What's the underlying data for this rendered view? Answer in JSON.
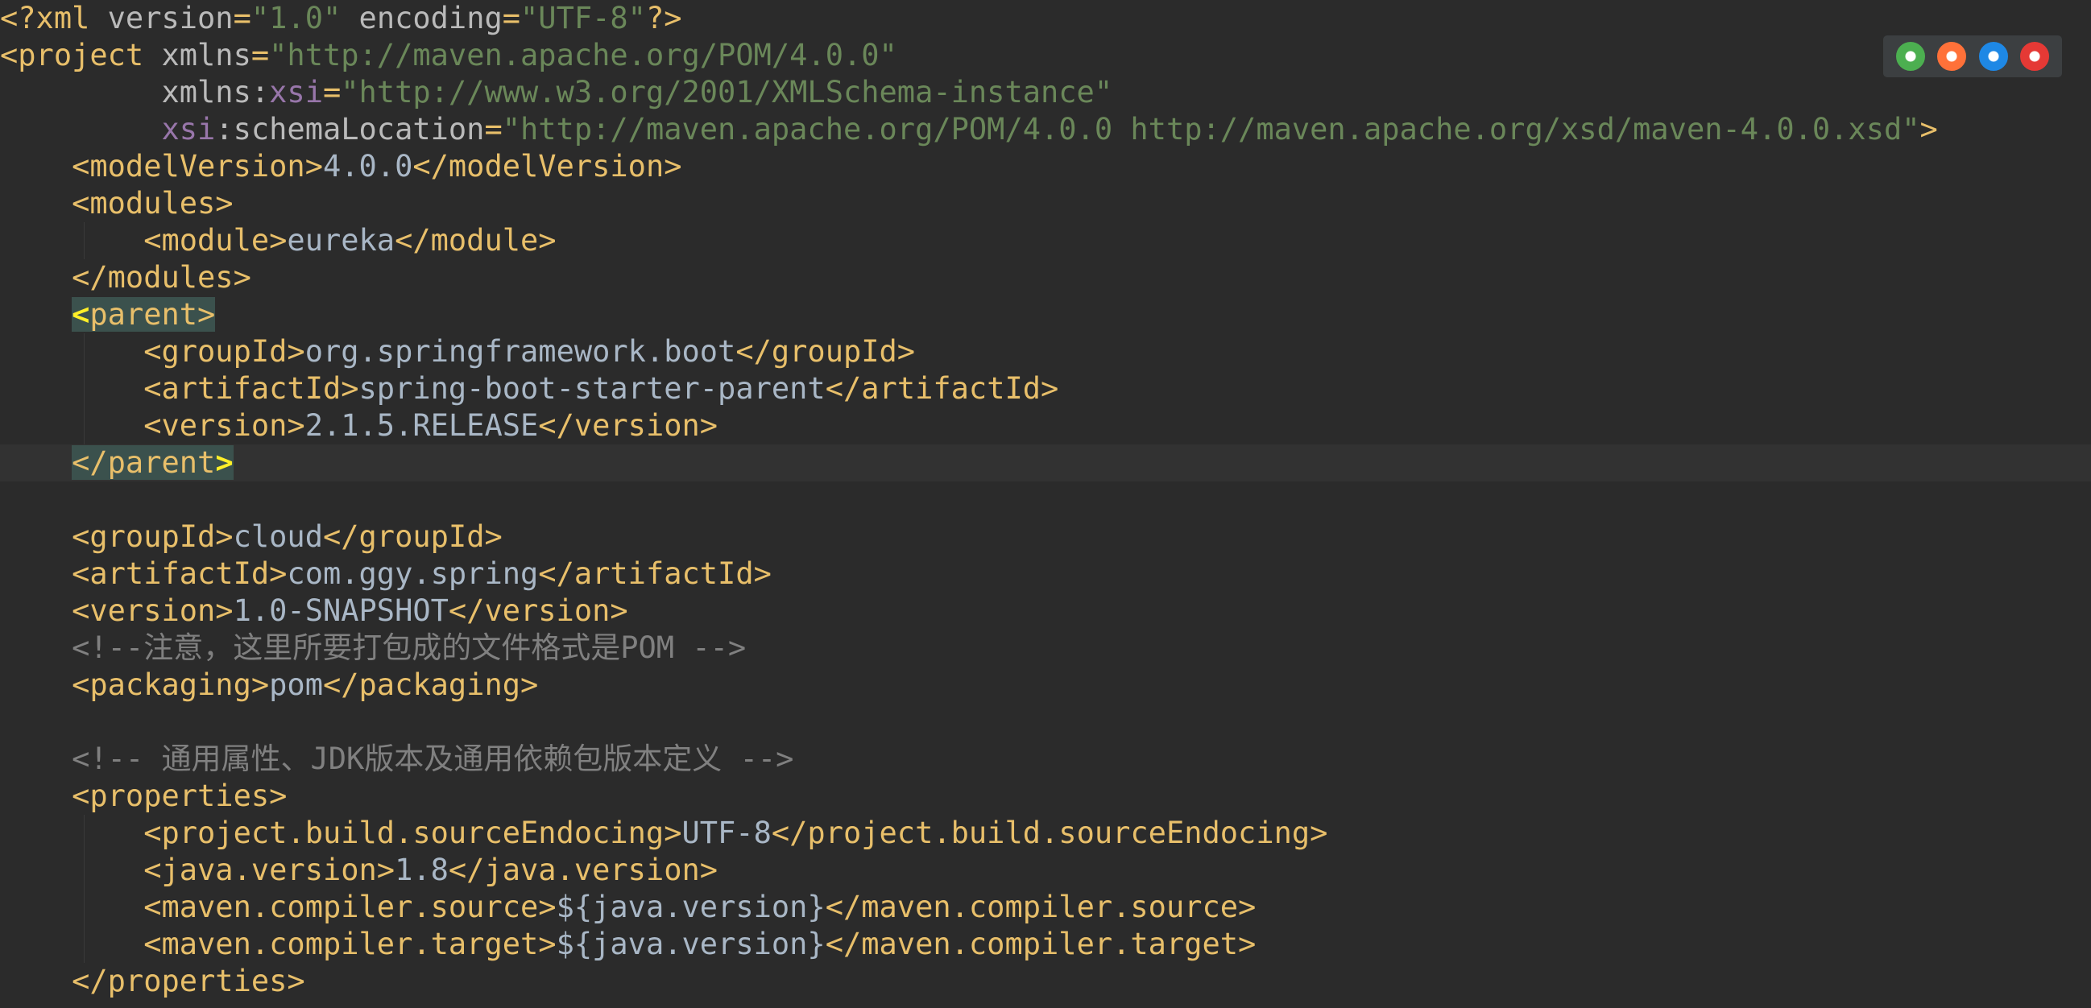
{
  "editor": {
    "lines": [
      {
        "segments": [
          [
            "tag",
            "<?xml "
          ],
          [
            "attr",
            "version"
          ],
          [
            "tag",
            "="
          ],
          [
            "str",
            "\"1.0\""
          ],
          [
            "attr",
            " encoding"
          ],
          [
            "tag",
            "="
          ],
          [
            "str",
            "\"UTF-8\""
          ],
          [
            "tag",
            "?>"
          ]
        ]
      },
      {
        "segments": [
          [
            "tag",
            "<project "
          ],
          [
            "attr",
            "xmlns"
          ],
          [
            "tag",
            "="
          ],
          [
            "str",
            "\"http://maven.apache.org/POM/4.0.0\""
          ]
        ]
      },
      {
        "segments": [
          [
            "attr",
            "         xmlns:"
          ],
          [
            "ns",
            "xsi"
          ],
          [
            "tag",
            "="
          ],
          [
            "str",
            "\"http://www.w3.org/2001/XMLSchema-instance\""
          ]
        ]
      },
      {
        "segments": [
          [
            "ns",
            "         xsi"
          ],
          [
            "attr",
            ":schemaLocation"
          ],
          [
            "tag",
            "="
          ],
          [
            "str",
            "\"http://maven.apache.org/POM/4.0.0 http://maven.apache.org/xsd/maven-4.0.0.xsd\""
          ],
          [
            "tag",
            ">"
          ]
        ]
      },
      {
        "segments": [
          [
            "tag",
            "    <modelVersion>"
          ],
          [
            "txt",
            "4.0.0"
          ],
          [
            "tag",
            "</modelVersion>"
          ]
        ]
      },
      {
        "segments": [
          [
            "tag",
            "    <modules>"
          ]
        ]
      },
      {
        "segments": [
          [
            "tag",
            "        <module>"
          ],
          [
            "txt",
            "eureka"
          ],
          [
            "tag",
            "</module>"
          ]
        ]
      },
      {
        "segments": [
          [
            "tag",
            "    </modules>"
          ]
        ]
      },
      {
        "segments": [
          [
            "txt",
            "    "
          ],
          [
            "match-strong",
            "<"
          ],
          [
            "match",
            "parent>"
          ]
        ]
      },
      {
        "segments": [
          [
            "tag",
            "        <groupId>"
          ],
          [
            "txt",
            "org.springframework.boot"
          ],
          [
            "tag",
            "</groupId>"
          ]
        ]
      },
      {
        "segments": [
          [
            "tag",
            "        <artifactId>"
          ],
          [
            "txt",
            "spring-boot-starter-parent"
          ],
          [
            "tag",
            "</artifactId>"
          ]
        ]
      },
      {
        "segments": [
          [
            "tag",
            "        <version>"
          ],
          [
            "txt",
            "2.1.5.RELEASE"
          ],
          [
            "tag",
            "</version>"
          ]
        ]
      },
      {
        "segments": [
          [
            "txt",
            "    "
          ],
          [
            "match",
            "</parent"
          ],
          [
            "match-strong",
            ">"
          ]
        ],
        "current": true
      },
      {
        "segments": []
      },
      {
        "segments": [
          [
            "tag",
            "    <groupId>"
          ],
          [
            "txt",
            "cloud"
          ],
          [
            "tag",
            "</groupId>"
          ]
        ]
      },
      {
        "segments": [
          [
            "tag",
            "    <artifactId>"
          ],
          [
            "txt",
            "com.ggy.spring"
          ],
          [
            "tag",
            "</artifactId>"
          ]
        ]
      },
      {
        "segments": [
          [
            "tag",
            "    <version>"
          ],
          [
            "txt",
            "1.0-SNAPSHOT"
          ],
          [
            "tag",
            "</version>"
          ]
        ]
      },
      {
        "segments": [
          [
            "cmt",
            "    <!--"
          ],
          [
            "cmt-cjk",
            "注意，这里所要打包成的文件格式是"
          ],
          [
            "cmt",
            "POM -->"
          ]
        ]
      },
      {
        "segments": [
          [
            "tag",
            "    <packaging>"
          ],
          [
            "txt",
            "pom"
          ],
          [
            "tag",
            "</packaging>"
          ]
        ]
      },
      {
        "segments": []
      },
      {
        "segments": [
          [
            "cmt",
            "    <!-- "
          ],
          [
            "cmt-cjk",
            "通用属性、"
          ],
          [
            "cmt",
            "JDK"
          ],
          [
            "cmt-cjk",
            "版本及通用依赖包版本定义"
          ],
          [
            "cmt",
            " -->"
          ]
        ]
      },
      {
        "segments": [
          [
            "tag",
            "    <properties>"
          ]
        ]
      },
      {
        "segments": [
          [
            "tag",
            "        <project.build.sourceEndocing>"
          ],
          [
            "txt",
            "UTF-8"
          ],
          [
            "tag",
            "</project.build.sourceEndocing>"
          ]
        ]
      },
      {
        "segments": [
          [
            "tag",
            "        <java.version>"
          ],
          [
            "txt",
            "1.8"
          ],
          [
            "tag",
            "</java.version>"
          ]
        ]
      },
      {
        "segments": [
          [
            "tag",
            "        <maven.compiler.source>"
          ],
          [
            "txt",
            "${java.version}"
          ],
          [
            "tag",
            "</maven.compiler.source>"
          ]
        ]
      },
      {
        "segments": [
          [
            "tag",
            "        <maven.compiler.target>"
          ],
          [
            "txt",
            "${java.version}"
          ],
          [
            "tag",
            "</maven.compiler.target>"
          ]
        ]
      },
      {
        "segments": [
          [
            "tag",
            "    </properties>"
          ]
        ]
      }
    ]
  },
  "browser_icons": [
    {
      "name": "chrome-icon",
      "color": "#4caf50"
    },
    {
      "name": "firefox-icon",
      "color": "#ff7139"
    },
    {
      "name": "safari-icon",
      "color": "#1e88e5"
    },
    {
      "name": "opera-icon",
      "color": "#e53935"
    }
  ]
}
